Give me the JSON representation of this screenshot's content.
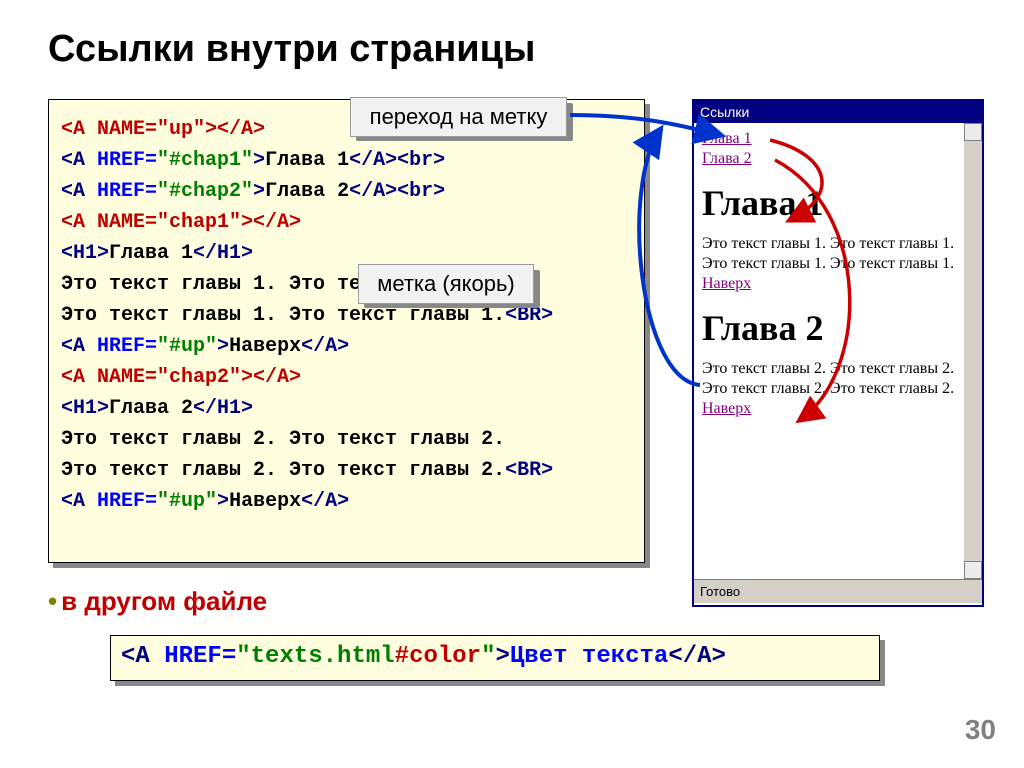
{
  "title": "Ссылки внутри страницы",
  "callouts": {
    "jump": "переход на метку",
    "anchor": "метка (якорь)"
  },
  "code": {
    "l1_a": "<A ",
    "l1_b": "NAME=",
    "l1_c": "\"up\"",
    "l1_d": "></A>",
    "l2_a": "<A ",
    "l2_b": "HREF=",
    "l2_c": "\"#chap1\"",
    "l2_d": ">",
    "l2_e": "Глава 1",
    "l2_f": "</A><br>",
    "l3_a": "<A ",
    "l3_b": "HREF=",
    "l3_c": "\"#chap2\"",
    "l3_d": ">",
    "l3_e": "Глава 2",
    "l3_f": "</A><br>",
    "l4_a": "<A ",
    "l4_b": "NAME=",
    "l4_c": "\"chap1\"",
    "l4_d": "></A>",
    "l5_a": "<H1>",
    "l5_b": "Глава 1",
    "l5_c": "</H1>",
    "l6": "Это текст главы 1. Это текст главы 1.",
    "l7_a": "Это текст главы 1. Это текст главы 1.",
    "l7_b": "<BR>",
    "l8_a": "<A ",
    "l8_b": "HREF=",
    "l8_c": "\"#up\"",
    "l8_d": ">",
    "l8_e": "Наверх",
    "l8_f": "</A>",
    "l9_a": "<A ",
    "l9_b": "NAME=",
    "l9_c": "\"chap2\"",
    "l9_d": "></A>",
    "l10_a": "<H1>",
    "l10_b": "Глава 2",
    "l10_c": "</H1>",
    "l11": "Это текст главы 2. Это текст главы 2.",
    "l12_a": "Это текст главы 2. Это текст главы 2.",
    "l12_b": "<BR>",
    "l13_a": "<A ",
    "l13_b": "HREF=",
    "l13_c": "\"#up\"",
    "l13_d": ">",
    "l13_e": "Наверх",
    "l13_f": "</A>"
  },
  "bullet": "в другом файле",
  "code2": {
    "a": "<A ",
    "b": "HREF=",
    "c": "\"texts.html",
    "d": "#color",
    "e": "\"",
    "f": ">",
    "g": "Цвет текста",
    "h": "</A>"
  },
  "browser": {
    "win_title": "Ссылки",
    "link1": "Глава 1",
    "link2": "Глава 2",
    "h1_1": "Глава 1",
    "p1": "Это текст главы 1. Это текст главы 1. Это текст главы 1. Это текст главы 1.",
    "up1": "Наверх",
    "h1_2": "Глава 2",
    "p2": "Это текст главы 2. Это текст главы 2. Это текст главы 2. Это текст главы 2.",
    "up2": "Наверх",
    "status": "Готово"
  },
  "pagenum": "30"
}
